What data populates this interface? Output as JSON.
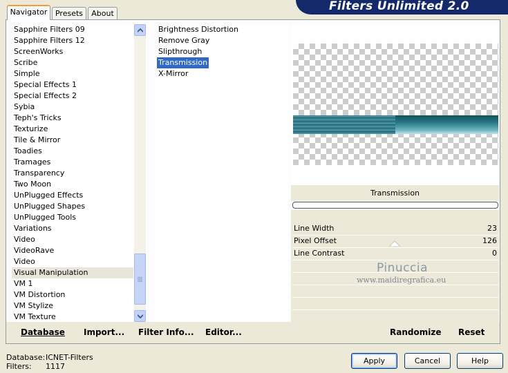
{
  "app": {
    "title": "Filters Unlimited 2.0"
  },
  "tabs": [
    {
      "label": "Navigator",
      "active": true
    },
    {
      "label": "Presets",
      "active": false
    },
    {
      "label": "About",
      "active": false
    }
  ],
  "categories": {
    "items": [
      "Sapphire Filters 09",
      "Sapphire Filters 12",
      "ScreenWorks",
      "Scribe",
      "Simple",
      "Special Effects 1",
      "Special Effects 2",
      "Sybia",
      "Teph's Tricks",
      "Texturize",
      "Tile & Mirror",
      "Toadies",
      "Tramages",
      "Transparency",
      "Two Moon",
      "UnPlugged Effects",
      "UnPlugged Shapes",
      "UnPlugged Tools",
      "Variations",
      "Video",
      "VideoRave",
      "Video",
      "Visual Manipulation",
      "VM 1",
      "VM Distortion",
      "VM Stylize",
      "VM Texture"
    ],
    "selected": "Visual Manipulation"
  },
  "filters": {
    "items": [
      "Brightness Distortion",
      "Remove Gray",
      "Slipthrough",
      "Transmission",
      "X-Mirror"
    ],
    "selected": "Transmission"
  },
  "preview": {
    "filter_name": "Transmission",
    "params": [
      {
        "label": "Line Width",
        "value": "23"
      },
      {
        "label": "Pixel Offset",
        "value": "126"
      },
      {
        "label": "Line Contrast",
        "value": "0"
      }
    ],
    "watermark_name": "Pinuccia",
    "watermark_url": "www.maidiregrafica.eu"
  },
  "footer": {
    "database": "Database",
    "import": "Import...",
    "filter_info": "Filter Info...",
    "editor": "Editor...",
    "randomize": "Randomize",
    "reset": "Reset"
  },
  "status": {
    "database_label": "Database:",
    "database_value": "ICNET-Filters",
    "filters_label": "Filters:",
    "filters_value": "1117"
  },
  "buttons": {
    "apply": "Apply",
    "cancel": "Cancel",
    "help": "Help"
  },
  "colors": {
    "banner": "#14296a",
    "selection": "#316ac5",
    "accent_tab": "#f0a030"
  }
}
